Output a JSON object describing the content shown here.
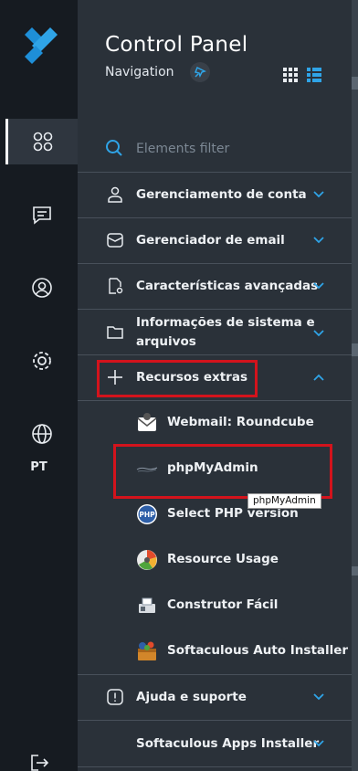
{
  "rail": {
    "language": "PT"
  },
  "panel": {
    "title": "Control Panel",
    "subtitle": "Navigation",
    "filter_placeholder": "Elements filter",
    "sections": [
      {
        "label": "Gerenciamento de conta",
        "icon": "user-icon"
      },
      {
        "label": "Gerenciador de email",
        "icon": "mail-icon"
      },
      {
        "label": "Características avançadas",
        "icon": "advanced-settings-icon"
      },
      {
        "label_line1": "Informações de sistema e",
        "label_line2": "arquivos",
        "icon": "folder-icon"
      },
      {
        "label": "Recursos extras",
        "icon": "plus-icon",
        "expanded": true
      },
      {
        "label": "Ajuda e suporte",
        "icon": "alert-icon"
      },
      {
        "label": "Softaculous Apps Installer",
        "icon": ""
      }
    ],
    "extras": [
      {
        "label": "Webmail: Roundcube",
        "icon": "roundcube-icon"
      },
      {
        "label": "phpMyAdmin",
        "icon": "phpmyadmin-icon"
      },
      {
        "label": "Select PHP version",
        "icon": "php-icon"
      },
      {
        "label": "Resource Usage",
        "icon": "resource-usage-icon"
      },
      {
        "label": "Construtor Fácil",
        "icon": "builder-icon"
      },
      {
        "label": "Softaculous Auto Installer",
        "icon": "softaculous-icon"
      }
    ]
  },
  "tooltip": "phpMyAdmin",
  "colors": {
    "accent": "#2fa4e7",
    "highlight": "#d3131c",
    "rail_bg": "#161b21",
    "panel_bg": "#2a3139"
  }
}
